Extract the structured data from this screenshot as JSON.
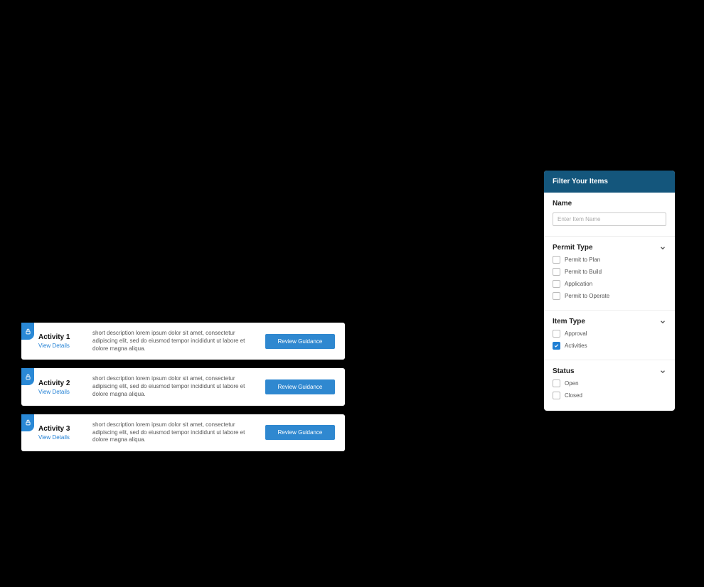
{
  "activities": [
    {
      "title": "Activity 1",
      "link": "View Details",
      "desc": "short description lorem ipsum dolor sit amet, consectetur adipiscing elit, sed do eiusmod tempor incididunt ut labore et dolore magna aliqua.",
      "button": "Review Guidance"
    },
    {
      "title": "Activity 2",
      "link": "View Details",
      "desc": "short description lorem ipsum dolor sit amet, consectetur adipiscing elit, sed do eiusmod tempor incididunt ut labore et dolore magna aliqua.",
      "button": "Review Guidance"
    },
    {
      "title": "Activity 3",
      "link": "View Details",
      "desc": "short description lorem ipsum dolor sit amet, consectetur adipiscing elit, sed do eiusmod tempor incididunt ut labore et dolore magna aliqua.",
      "button": "Review Guidance"
    }
  ],
  "filter": {
    "header": "Filter Your Items",
    "name": {
      "label": "Name",
      "placeholder": "Enter Item Name"
    },
    "permit_type": {
      "label": "Permit Type",
      "options": [
        {
          "label": "Permit to Plan",
          "checked": false
        },
        {
          "label": "Permit to Build",
          "checked": false
        },
        {
          "label": "Application",
          "checked": false
        },
        {
          "label": "Permit to Operate",
          "checked": false
        }
      ]
    },
    "item_type": {
      "label": "Item Type",
      "options": [
        {
          "label": "Approval",
          "checked": false
        },
        {
          "label": "Activities",
          "checked": true
        }
      ]
    },
    "status": {
      "label": "Status",
      "options": [
        {
          "label": "Open",
          "checked": false
        },
        {
          "label": "Closed",
          "checked": false
        }
      ]
    }
  }
}
